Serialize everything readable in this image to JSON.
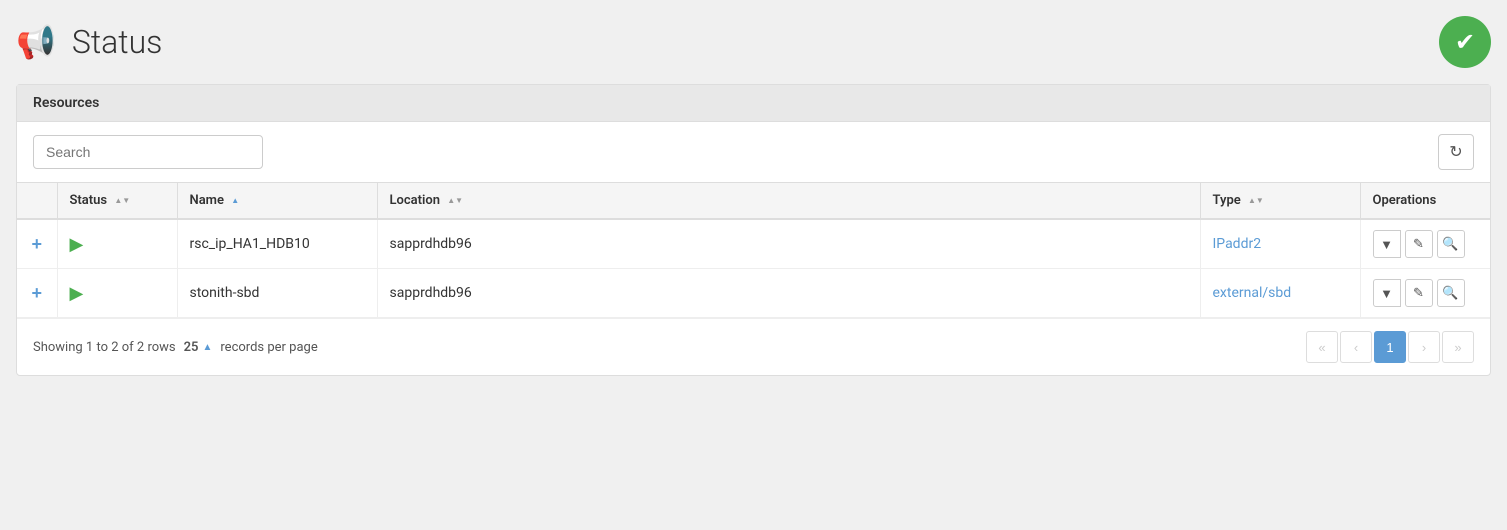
{
  "header": {
    "title": "Status",
    "status_ok": true
  },
  "resources_section": {
    "label": "Resources",
    "search_placeholder": "Search",
    "table": {
      "columns": [
        {
          "key": "expand",
          "label": ""
        },
        {
          "key": "status",
          "label": "Status",
          "sortable": true,
          "sort": "neutral"
        },
        {
          "key": "name",
          "label": "Name",
          "sortable": true,
          "sort": "asc"
        },
        {
          "key": "location",
          "label": "Location",
          "sortable": true,
          "sort": "neutral"
        },
        {
          "key": "type",
          "label": "Type",
          "sortable": true,
          "sort": "neutral"
        },
        {
          "key": "operations",
          "label": "Operations",
          "sortable": false
        }
      ],
      "rows": [
        {
          "id": 1,
          "name": "rsc_ip_HA1_HDB10",
          "location": "sapprdhdb96",
          "type": "IPaddr2",
          "type_link": true,
          "status_running": true
        },
        {
          "id": 2,
          "name": "stonith-sbd",
          "location": "sapprdhdb96",
          "type": "external/sbd",
          "type_link": true,
          "status_running": true
        }
      ]
    }
  },
  "footer": {
    "showing_text": "Showing 1 to 2 of 2 rows",
    "per_page": "25",
    "per_page_label": "records per page",
    "current_page": 1,
    "pagination": {
      "first": "«",
      "prev": "‹",
      "next": "›",
      "last": "»"
    }
  }
}
